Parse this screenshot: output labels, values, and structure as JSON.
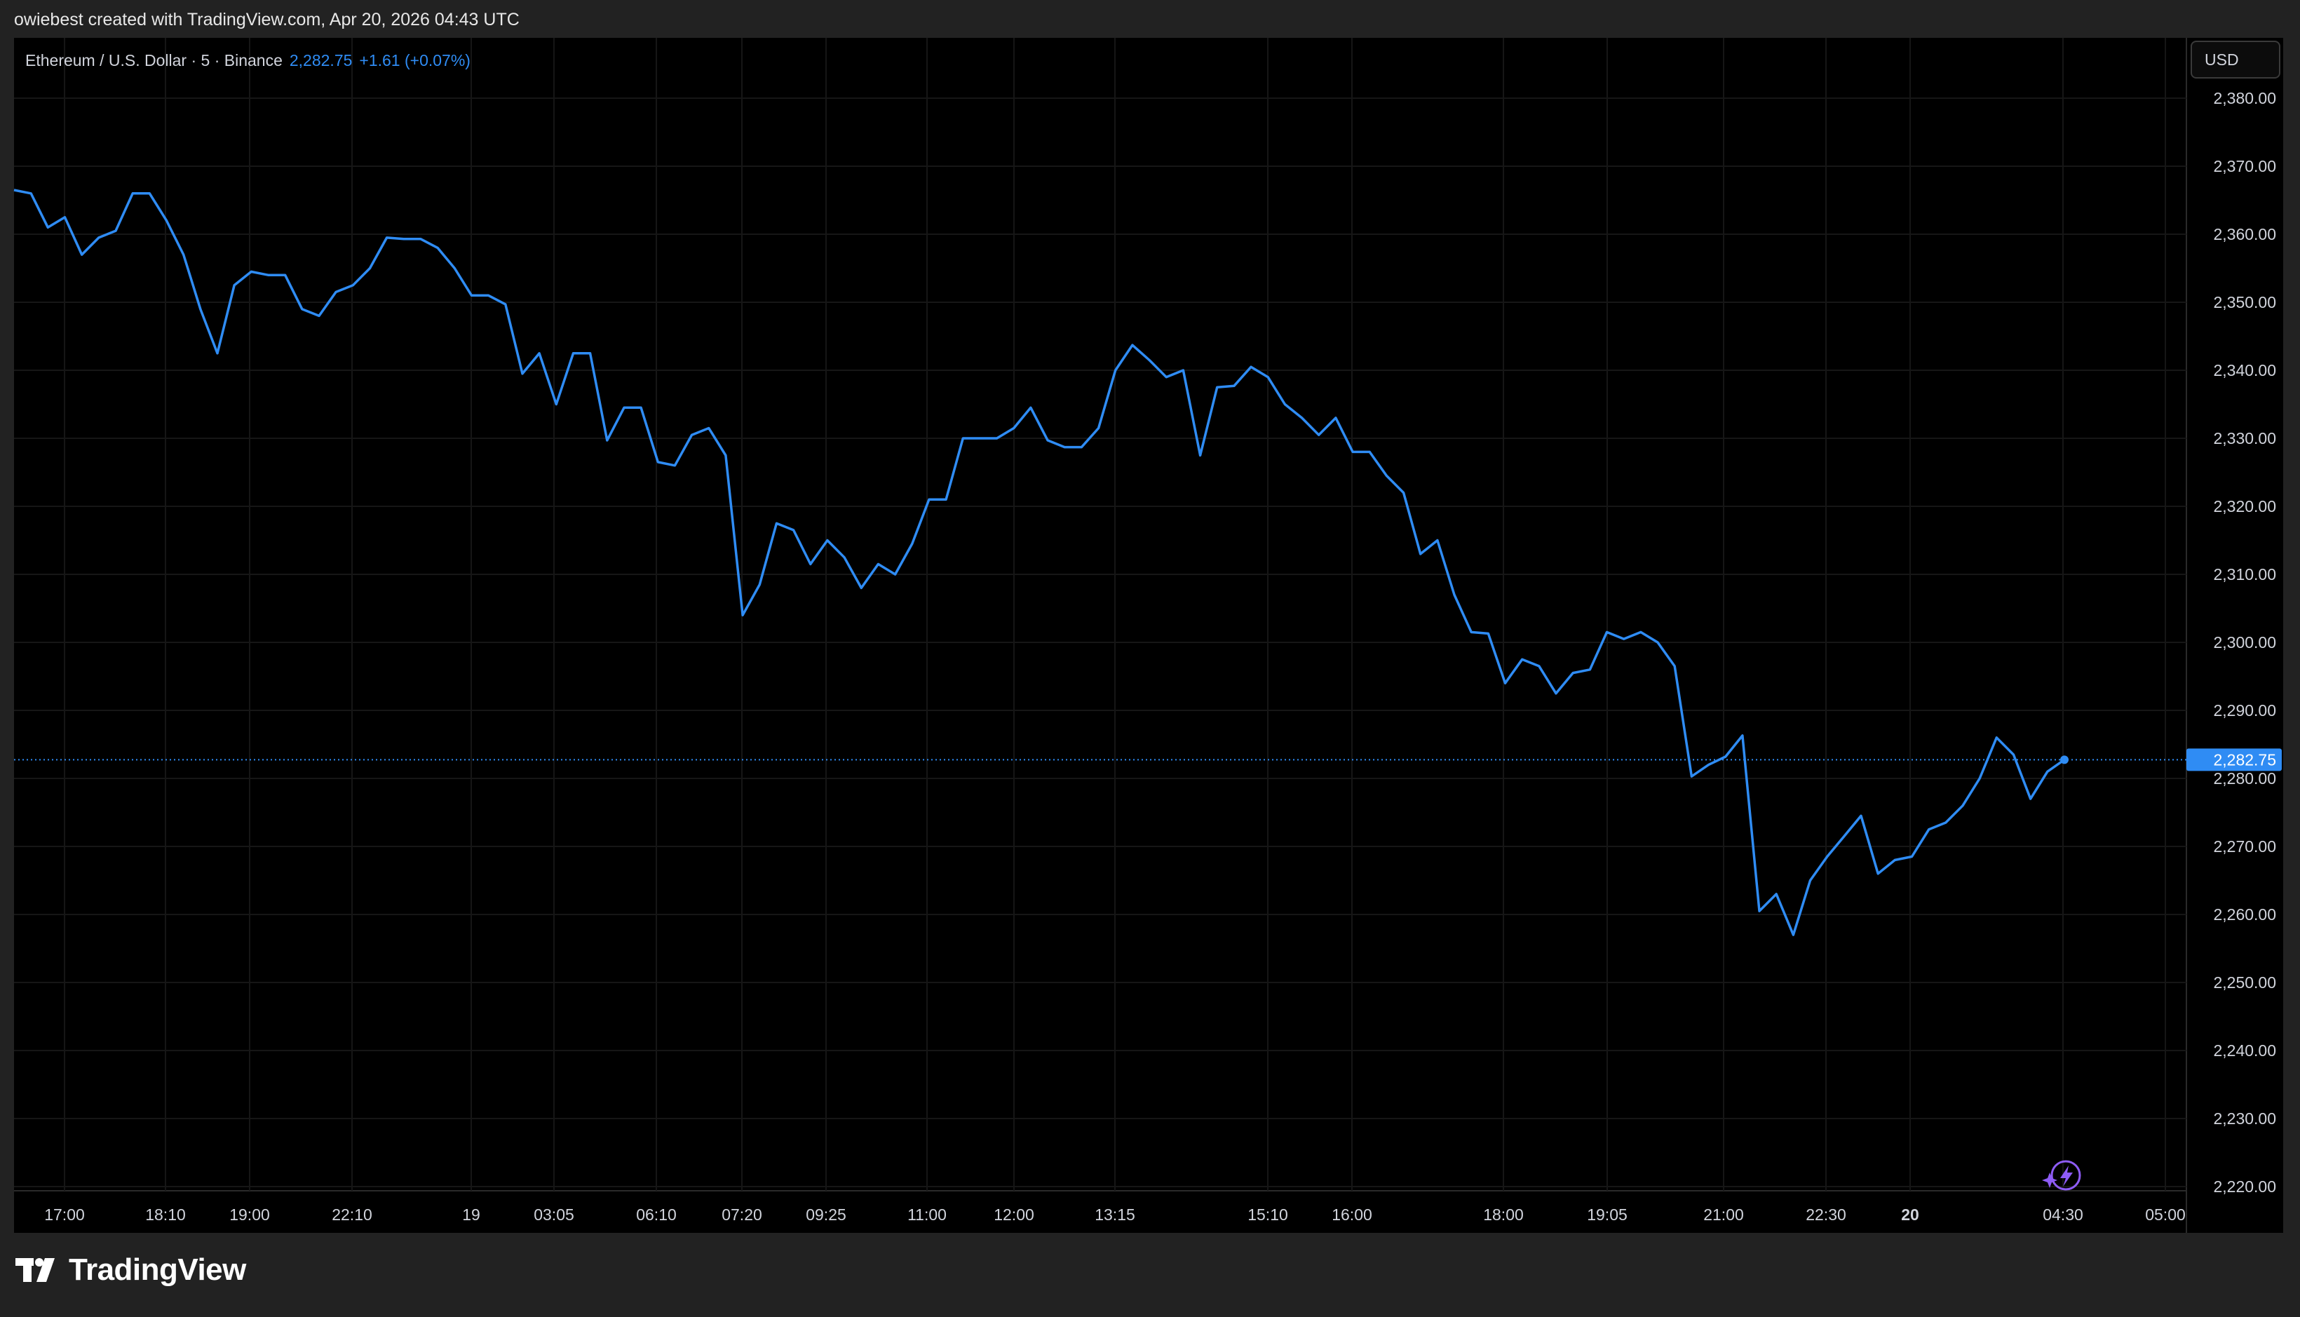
{
  "attribution": "owiebest created with TradingView.com, Apr 20, 2026 04:43 UTC",
  "legend": {
    "symbol": "Ethereum / U.S. Dollar · 5 · Binance",
    "price": "2,282.75",
    "change": "+1.61 (+0.07%)"
  },
  "currency_button": "USD",
  "brand": {
    "name": "TradingView",
    "icon": "tradingview-logo-icon"
  },
  "colors": {
    "line": "#2f8cf4",
    "price_label_bg": "#2f8cf4",
    "background": "#000000",
    "frame": "#222222",
    "grid": "#161616",
    "assistant_icon": "#8e5cf6"
  },
  "chart_data": {
    "type": "line",
    "ylim": [
      2220,
      2385
    ],
    "y_tick_labels": [
      "2,380.00",
      "2,370.00",
      "2,360.00",
      "2,350.00",
      "2,340.00",
      "2,330.00",
      "2,320.00",
      "2,310.00",
      "2,300.00",
      "2,290.00",
      "2,280.00",
      "2,270.00",
      "2,260.00",
      "2,250.00",
      "2,240.00",
      "2,230.00",
      "2,220.00"
    ],
    "y_ticks": [
      2380,
      2370,
      2360,
      2350,
      2340,
      2330,
      2320,
      2310,
      2300,
      2290,
      2280,
      2270,
      2260,
      2250,
      2240,
      2230,
      2220
    ],
    "x_tick_labels": [
      "17:00",
      "18:10",
      "19:00",
      "22:10",
      "19",
      "03:05",
      "06:10",
      "07:20",
      "09:25",
      "11:00",
      "12:00",
      "13:15",
      "15:10",
      "16:00",
      "18:00",
      "19:05",
      "21:00",
      "22:30",
      "20",
      "04:30",
      "05:00"
    ],
    "x_tick_bold": [
      "20"
    ],
    "last_price": 2282.75,
    "last_price_label": "2,282.75",
    "grid": true,
    "series": [
      {
        "values": [
          2366.5,
          2366,
          2361,
          2362.5,
          2357,
          2359.5,
          2360.5,
          2366,
          2366,
          2362,
          2357,
          2349,
          2342.5,
          2352.5,
          2354.5,
          2354,
          2354,
          2349,
          2348,
          2351.5,
          2352.5,
          2355,
          2359.5,
          2359.3,
          2359.3,
          2358,
          2355,
          2351,
          2351,
          2349.7,
          2339.5,
          2342.5,
          2335,
          2342.5,
          2342.5,
          2329.7,
          2334.5,
          2334.5,
          2326.5,
          2326,
          2330.5,
          2331.5,
          2327.5,
          2304,
          2308.5,
          2317.5,
          2316.5,
          2311.5,
          2315,
          2312.5,
          2308,
          2311.5,
          2310,
          2314.5,
          2321,
          2321,
          2330,
          2330,
          2330,
          2331.5,
          2334.5,
          2329.7,
          2328.7,
          2328.7,
          2331.5,
          2340,
          2343.7,
          2341.5,
          2339,
          2340,
          2327.5,
          2337.5,
          2337.7,
          2340.5,
          2339,
          2335,
          2333,
          2330.5,
          2333,
          2328,
          2328,
          2324.5,
          2322,
          2313,
          2315,
          2307,
          2301.5,
          2301.3,
          2294,
          2297.5,
          2296.5,
          2292.5,
          2295.5,
          2296,
          2301.5,
          2300.5,
          2301.5,
          2300,
          2296.5,
          2280.3,
          2282,
          2283.2,
          2286.3,
          2260.5,
          2263,
          2257,
          2265,
          2268.5,
          2271.5,
          2274.5,
          2266,
          2268,
          2268.5,
          2272.5,
          2273.5,
          2276,
          2280,
          2286,
          2283.5,
          2277,
          2281,
          2282.75
        ]
      }
    ]
  }
}
